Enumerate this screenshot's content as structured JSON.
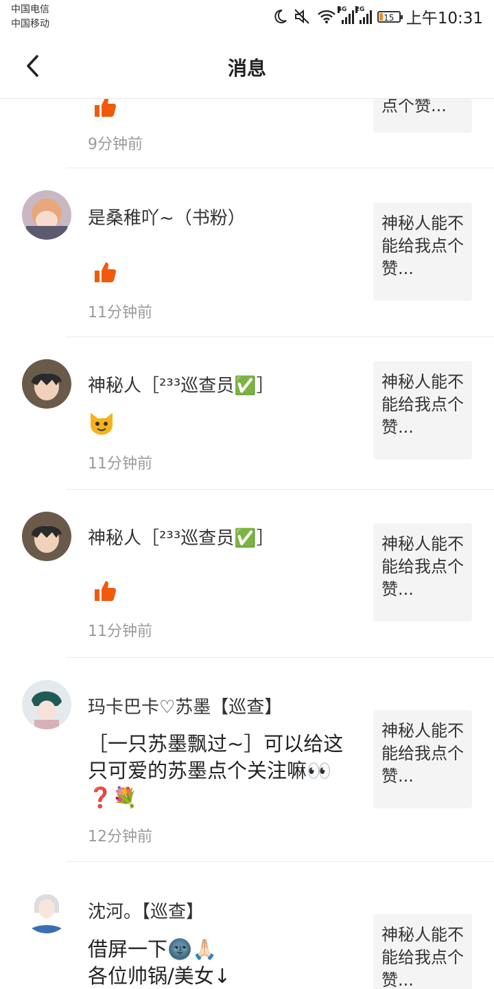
{
  "status": {
    "carrier1": "中国电信",
    "carrier2": "中国移动",
    "net1": "4G",
    "net2": "2G",
    "battery": "15",
    "time": "上午10:31"
  },
  "header": {
    "title": "消息"
  },
  "items": [
    {
      "time": "9分钟前",
      "ref": "点个赞..."
    },
    {
      "name": "是桑稚吖~（书粉）",
      "time": "11分钟前",
      "ref": "神秘人能不能给我点个赞..."
    },
    {
      "name": "神秘人［²³³巡查员✅］",
      "time": "11分钟前",
      "ref": "神秘人能不能给我点个赞..."
    },
    {
      "name": "神秘人［²³³巡查员✅］",
      "time": "11分钟前",
      "ref": "神秘人能不能给我点个赞..."
    },
    {
      "name": "玛卡巴卡♡苏墨【巡查】",
      "content": "［一只苏墨飘过~］可以给这只可爱的苏墨点个关注嘛👀❓💐",
      "time": "12分钟前",
      "ref": "神秘人能不能给我点个赞..."
    },
    {
      "name": "沈河。【巡查】",
      "content_line1": "借屏一下🌚🙏🏻",
      "content_line2": "各位帅锅/美女↓",
      "ref": "神秘人能不能给我点个赞..."
    }
  ],
  "colors": {
    "accent": "#f15a0a",
    "ref_bg": "#f4f4f4"
  }
}
